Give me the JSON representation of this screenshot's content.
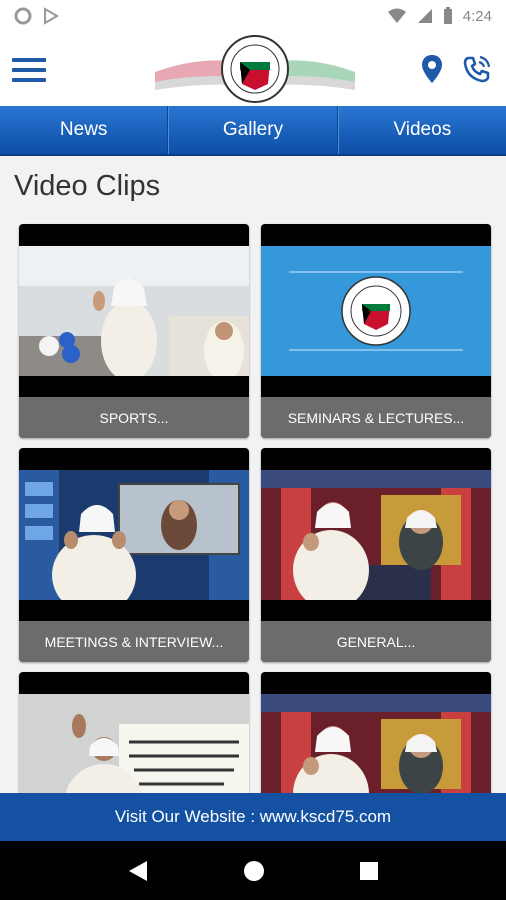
{
  "status_bar": {
    "time": "4:24"
  },
  "header": {
    "menu_icon": "hamburger-menu-icon",
    "logo_icon": "kscd-logo",
    "location_icon": "location-pin-icon",
    "phone_icon": "phone-icon"
  },
  "tabs": [
    {
      "label": "News"
    },
    {
      "label": "Gallery"
    },
    {
      "label": "Videos"
    }
  ],
  "page": {
    "title": "Video Clips"
  },
  "clips": [
    {
      "label": "SPORTS..."
    },
    {
      "label": "SEMINARS & LECTURES..."
    },
    {
      "label": "MEETINGS & INTERVIEW..."
    },
    {
      "label": "GENERAL..."
    },
    {
      "label": ""
    },
    {
      "label": ""
    }
  ],
  "footer": {
    "text": "Visit Our Website : www.kscd75.com"
  },
  "colors": {
    "primary": "#1451a3",
    "tab_gradient_top": "#2a76d2",
    "caption_bg": "#6c6c6c"
  }
}
